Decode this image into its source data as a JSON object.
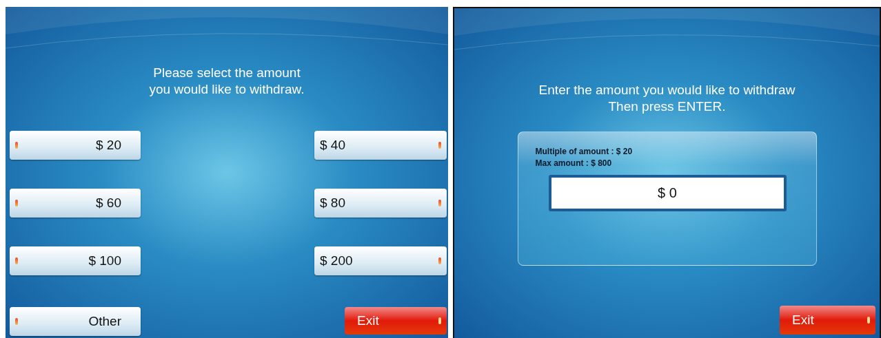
{
  "select_screen": {
    "heading_lines": [
      "Please select the amount",
      "you would like to withdraw."
    ],
    "left_buttons": [
      {
        "label": "$ 20"
      },
      {
        "label": "$ 60"
      },
      {
        "label": "$ 100"
      },
      {
        "label": "Other"
      }
    ],
    "right_buttons": [
      {
        "label": "$ 40"
      },
      {
        "label": "$ 80"
      },
      {
        "label": "$ 200"
      }
    ],
    "exit_button": "Exit"
  },
  "enter_screen": {
    "heading_lines": [
      "Enter the amount you would like to withdraw",
      "Then press ENTER."
    ],
    "multiple_note": "Multiple of amount : $ 20",
    "max_note": "Max amount : $ 800",
    "amount_field": {
      "value": "$ 0"
    },
    "exit_button": "Exit"
  }
}
